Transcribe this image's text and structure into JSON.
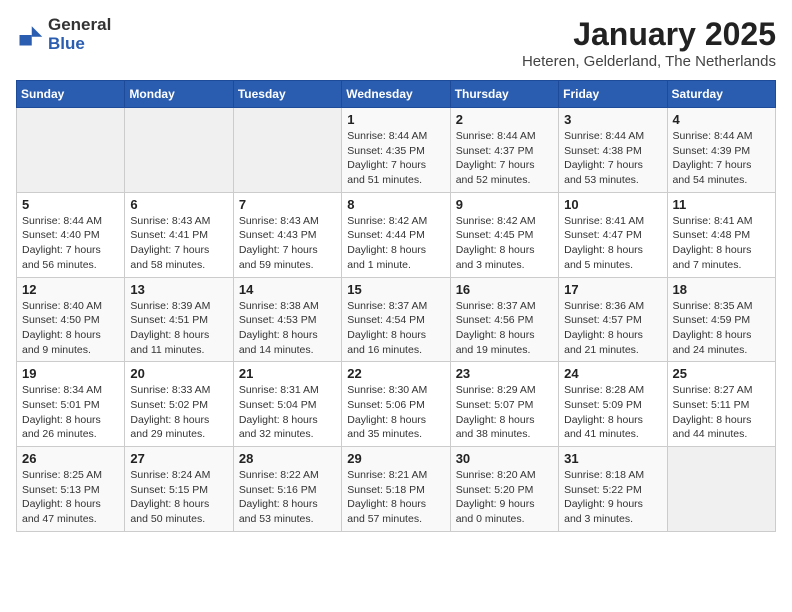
{
  "header": {
    "logo_line1": "General",
    "logo_line2": "Blue",
    "month_title": "January 2025",
    "location": "Heteren, Gelderland, The Netherlands"
  },
  "weekdays": [
    "Sunday",
    "Monday",
    "Tuesday",
    "Wednesday",
    "Thursday",
    "Friday",
    "Saturday"
  ],
  "weeks": [
    [
      {
        "day": "",
        "info": ""
      },
      {
        "day": "",
        "info": ""
      },
      {
        "day": "",
        "info": ""
      },
      {
        "day": "1",
        "info": "Sunrise: 8:44 AM\nSunset: 4:35 PM\nDaylight: 7 hours and 51 minutes."
      },
      {
        "day": "2",
        "info": "Sunrise: 8:44 AM\nSunset: 4:37 PM\nDaylight: 7 hours and 52 minutes."
      },
      {
        "day": "3",
        "info": "Sunrise: 8:44 AM\nSunset: 4:38 PM\nDaylight: 7 hours and 53 minutes."
      },
      {
        "day": "4",
        "info": "Sunrise: 8:44 AM\nSunset: 4:39 PM\nDaylight: 7 hours and 54 minutes."
      }
    ],
    [
      {
        "day": "5",
        "info": "Sunrise: 8:44 AM\nSunset: 4:40 PM\nDaylight: 7 hours and 56 minutes."
      },
      {
        "day": "6",
        "info": "Sunrise: 8:43 AM\nSunset: 4:41 PM\nDaylight: 7 hours and 58 minutes."
      },
      {
        "day": "7",
        "info": "Sunrise: 8:43 AM\nSunset: 4:43 PM\nDaylight: 7 hours and 59 minutes."
      },
      {
        "day": "8",
        "info": "Sunrise: 8:42 AM\nSunset: 4:44 PM\nDaylight: 8 hours and 1 minute."
      },
      {
        "day": "9",
        "info": "Sunrise: 8:42 AM\nSunset: 4:45 PM\nDaylight: 8 hours and 3 minutes."
      },
      {
        "day": "10",
        "info": "Sunrise: 8:41 AM\nSunset: 4:47 PM\nDaylight: 8 hours and 5 minutes."
      },
      {
        "day": "11",
        "info": "Sunrise: 8:41 AM\nSunset: 4:48 PM\nDaylight: 8 hours and 7 minutes."
      }
    ],
    [
      {
        "day": "12",
        "info": "Sunrise: 8:40 AM\nSunset: 4:50 PM\nDaylight: 8 hours and 9 minutes."
      },
      {
        "day": "13",
        "info": "Sunrise: 8:39 AM\nSunset: 4:51 PM\nDaylight: 8 hours and 11 minutes."
      },
      {
        "day": "14",
        "info": "Sunrise: 8:38 AM\nSunset: 4:53 PM\nDaylight: 8 hours and 14 minutes."
      },
      {
        "day": "15",
        "info": "Sunrise: 8:37 AM\nSunset: 4:54 PM\nDaylight: 8 hours and 16 minutes."
      },
      {
        "day": "16",
        "info": "Sunrise: 8:37 AM\nSunset: 4:56 PM\nDaylight: 8 hours and 19 minutes."
      },
      {
        "day": "17",
        "info": "Sunrise: 8:36 AM\nSunset: 4:57 PM\nDaylight: 8 hours and 21 minutes."
      },
      {
        "day": "18",
        "info": "Sunrise: 8:35 AM\nSunset: 4:59 PM\nDaylight: 8 hours and 24 minutes."
      }
    ],
    [
      {
        "day": "19",
        "info": "Sunrise: 8:34 AM\nSunset: 5:01 PM\nDaylight: 8 hours and 26 minutes."
      },
      {
        "day": "20",
        "info": "Sunrise: 8:33 AM\nSunset: 5:02 PM\nDaylight: 8 hours and 29 minutes."
      },
      {
        "day": "21",
        "info": "Sunrise: 8:31 AM\nSunset: 5:04 PM\nDaylight: 8 hours and 32 minutes."
      },
      {
        "day": "22",
        "info": "Sunrise: 8:30 AM\nSunset: 5:06 PM\nDaylight: 8 hours and 35 minutes."
      },
      {
        "day": "23",
        "info": "Sunrise: 8:29 AM\nSunset: 5:07 PM\nDaylight: 8 hours and 38 minutes."
      },
      {
        "day": "24",
        "info": "Sunrise: 8:28 AM\nSunset: 5:09 PM\nDaylight: 8 hours and 41 minutes."
      },
      {
        "day": "25",
        "info": "Sunrise: 8:27 AM\nSunset: 5:11 PM\nDaylight: 8 hours and 44 minutes."
      }
    ],
    [
      {
        "day": "26",
        "info": "Sunrise: 8:25 AM\nSunset: 5:13 PM\nDaylight: 8 hours and 47 minutes."
      },
      {
        "day": "27",
        "info": "Sunrise: 8:24 AM\nSunset: 5:15 PM\nDaylight: 8 hours and 50 minutes."
      },
      {
        "day": "28",
        "info": "Sunrise: 8:22 AM\nSunset: 5:16 PM\nDaylight: 8 hours and 53 minutes."
      },
      {
        "day": "29",
        "info": "Sunrise: 8:21 AM\nSunset: 5:18 PM\nDaylight: 8 hours and 57 minutes."
      },
      {
        "day": "30",
        "info": "Sunrise: 8:20 AM\nSunset: 5:20 PM\nDaylight: 9 hours and 0 minutes."
      },
      {
        "day": "31",
        "info": "Sunrise: 8:18 AM\nSunset: 5:22 PM\nDaylight: 9 hours and 3 minutes."
      },
      {
        "day": "",
        "info": ""
      }
    ]
  ]
}
